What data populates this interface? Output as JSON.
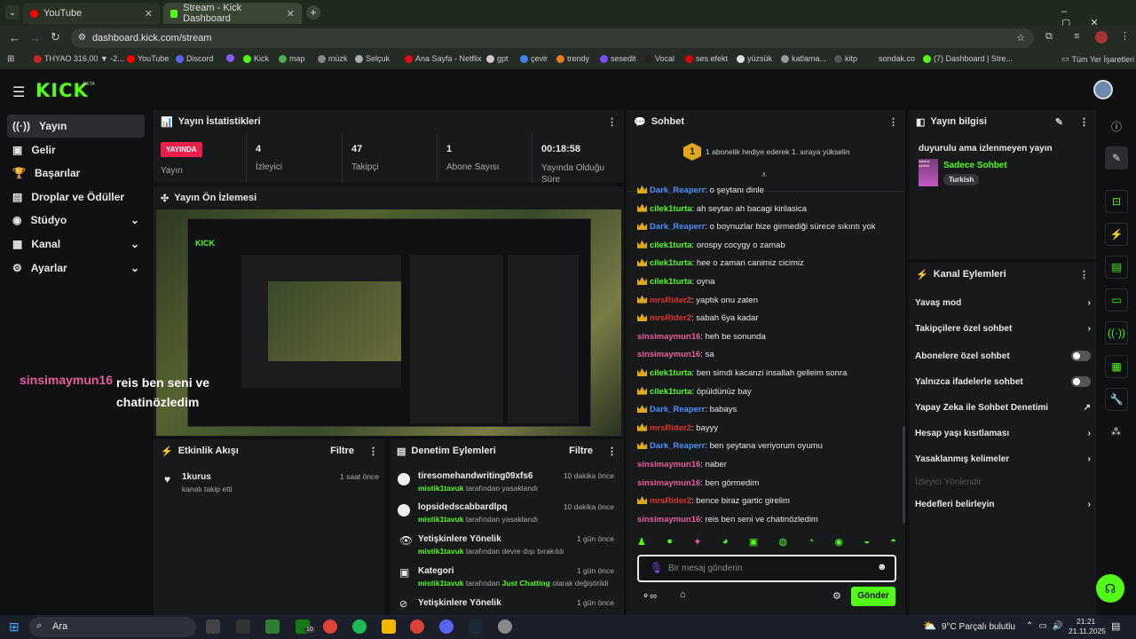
{
  "browser": {
    "tabs": [
      {
        "title": "YouTube"
      },
      {
        "title": "Stream - Kick Dashboard"
      }
    ],
    "url": "dashboard.kick.com/stream",
    "bookmarks": [
      "THYAO 316,00 ▼ -2...",
      "YouTube",
      "Discord",
      "Kick",
      "map",
      "müzk",
      "Selçuk",
      "Ana Sayfa - Netflix",
      "gpt",
      "çevir",
      "trendy",
      "sesedit",
      "Vocal",
      "ses efekt",
      "yüzsük",
      "katlama...",
      "kitp",
      "sondak.co",
      "(7) Dashboard | Stre...",
      "Tüm Yer İşaretleri"
    ]
  },
  "header": {
    "logo": "KICK",
    "beta": "BETA"
  },
  "nav": [
    {
      "label": "Yayın"
    },
    {
      "label": "Gelir"
    },
    {
      "label": "Başarılar"
    },
    {
      "label": "Droplar ve Ödüller"
    },
    {
      "label": "Stüdyo"
    },
    {
      "label": "Kanal"
    },
    {
      "label": "Ayarlar"
    }
  ],
  "stats": {
    "title": "Yayın İstatistikleri",
    "live_badge": "YAYINDA",
    "live_label": "Yayın",
    "items": [
      {
        "value": "4",
        "label": "İzleyici"
      },
      {
        "value": "47",
        "label": "Takipçi"
      },
      {
        "value": "1",
        "label": "Abone Sayısı"
      },
      {
        "value": "00:18:58",
        "label": "Yayında Olduğu Süre"
      }
    ]
  },
  "preview": {
    "title": "Yayın Ön İzlemesi",
    "overlay_user": "sinsimaymun16",
    "overlay_text": "reis ben seni ve chatinözledim"
  },
  "activity": {
    "title": "Etkinlik Akışı",
    "filter": "Filtre",
    "items": [
      {
        "user": "1kurus",
        "text": "kanalı takip etti",
        "time": "1 saat önce"
      }
    ]
  },
  "moderation": {
    "title": "Denetim Eylemleri",
    "filter": "Filtre",
    "items": [
      {
        "title": "tiresomehandwriting09xfs6",
        "mod": "mistik1tavuk",
        "text": "tarafından yasaklandı",
        "time": "10 dakika önce"
      },
      {
        "title": "lopsidedscabbardlpq",
        "mod": "mistik1tavuk",
        "text": "tarafından yasaklandı",
        "time": "10 dakika önce"
      },
      {
        "title": "Yetişkinlere Yönelik",
        "mod": "mistik1tavuk",
        "text": "tarafından devre dışı bırakıldı",
        "time": "1 gün önce"
      },
      {
        "title": "Kategori",
        "mod": "mistik1tavuk",
        "text": "tarafından",
        "extra": "Just Chatting",
        "text2": "olarak değiştirildi",
        "time": "1 gün önce"
      },
      {
        "title": "Yetişkinlere Yönelik",
        "time": "1 gün önce"
      }
    ]
  },
  "chat": {
    "title": "Sohbet",
    "gift_num": "1",
    "gift_text": "1 abonelik hediye ederek 1. sıraya yükselin",
    "placeholder": "Bir mesaj gönderin",
    "send": "Gönder",
    "messages": [
      {
        "user": "Dark_Reaperr",
        "text": "o şeytanı dinle",
        "color": "#4a90ff",
        "badge": true
      },
      {
        "user": "cilek1turta",
        "text": "ah seytan ah bacagi kirilasica",
        "color": "#53fc18",
        "badge": true
      },
      {
        "user": "Dark_Reaperr",
        "text": "o boynuzlar bize girmediği sürece sıkıntı yok",
        "color": "#4a90ff",
        "badge": true
      },
      {
        "user": "cilek1turta",
        "text": "orospy cocygy o zamab",
        "color": "#53fc18",
        "badge": true
      },
      {
        "user": "cilek1turta",
        "text": "hee o zaman canimiz cicimiz",
        "color": "#53fc18",
        "badge": true
      },
      {
        "user": "cilek1turta",
        "text": "oyna",
        "color": "#53fc18",
        "badge": true
      },
      {
        "user": "mrsRider2",
        "text": "yaptık onu zaten",
        "color": "#e0342b",
        "badge": true
      },
      {
        "user": "mrsRider2",
        "text": "sabah 6ya kadar",
        "color": "#e0342b",
        "badge": true
      },
      {
        "user": "sinsimaymun16",
        "text": "heh be sonunda",
        "color": "#e85d9b",
        "badge": false
      },
      {
        "user": "sinsimaymun16",
        "text": "sa",
        "color": "#e85d9b",
        "badge": false
      },
      {
        "user": "cilek1turta",
        "text": "ben simdi kacanzi insallah gelleim sonra",
        "color": "#53fc18",
        "badge": true
      },
      {
        "user": "cilek1turta",
        "text": "öpüldünüz bay",
        "color": "#53fc18",
        "badge": true
      },
      {
        "user": "Dark_Reaperr",
        "text": "babays",
        "color": "#4a90ff",
        "badge": true
      },
      {
        "user": "mrsRider2",
        "text": "bayyy",
        "color": "#e0342b",
        "badge": true
      },
      {
        "user": "Dark_Reaperr",
        "text": "ben şeytana veriyorum oyumu",
        "color": "#4a90ff",
        "badge": true
      },
      {
        "user": "sinsimaymun16",
        "text": "naber",
        "color": "#e85d9b",
        "badge": false
      },
      {
        "user": "sinsimaymun16",
        "text": "ben görmedim",
        "color": "#e85d9b",
        "badge": false
      },
      {
        "user": "mrsRider2",
        "text": "bence biraz gartic girelim",
        "color": "#e0342b",
        "badge": true
      },
      {
        "user": "sinsimaymun16",
        "text": "reis ben seni ve chatinözledim",
        "color": "#e85d9b",
        "badge": false
      }
    ]
  },
  "info": {
    "title": "Yayın bilgisi",
    "stream_title": "duyurulu ama izlenmeyen yayın",
    "category": "Sadece Sohbet",
    "tag": "Turkish",
    "thumb_text": "sadece sohbet"
  },
  "channel_actions": {
    "title": "Kanal Eylemleri",
    "items": [
      {
        "label": "Yavaş mod",
        "kind": "arrow"
      },
      {
        "label": "Takipçilere özel sohbet",
        "kind": "arrow"
      },
      {
        "label": "Abonelere özel sohbet",
        "kind": "toggle"
      },
      {
        "label": "Yalnızca ifadelerle sohbet",
        "kind": "toggle"
      },
      {
        "label": "Yapay Zeka ile Sohbet Denetimi",
        "kind": "ext"
      },
      {
        "label": "Hesap yaşı kısıtlaması",
        "kind": "arrow"
      },
      {
        "label": "Yasaklanmış kelimeler",
        "kind": "arrow"
      },
      {
        "label": "İzleyici Yönlendir",
        "kind": "disabled"
      },
      {
        "label": "Hedefleri belirleyin",
        "kind": "arrow"
      }
    ]
  },
  "taskbar": {
    "search": "Ara",
    "weather": "9°C  Parçalı bulutlu",
    "time": "21:21",
    "date": "21.11.2025",
    "badge": "10"
  },
  "colors": {
    "accent": "#53fc18",
    "live": "#e91f4c"
  }
}
